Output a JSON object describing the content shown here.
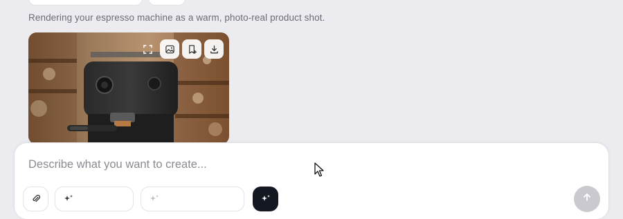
{
  "status": {
    "message": "Rendering your espresso machine as a warm, photo-real product shot."
  },
  "image_card": {
    "tools": [
      {
        "name": "fullscreen-icon"
      },
      {
        "name": "image-icon"
      },
      {
        "name": "bookmark-add-icon"
      },
      {
        "name": "download-icon"
      }
    ]
  },
  "composer": {
    "placeholder": "Describe what you want to create...",
    "value": ""
  },
  "colors": {
    "page_bg": "#ECECF0",
    "magic_button": "#141820",
    "send_button": "#C9C9CF"
  }
}
